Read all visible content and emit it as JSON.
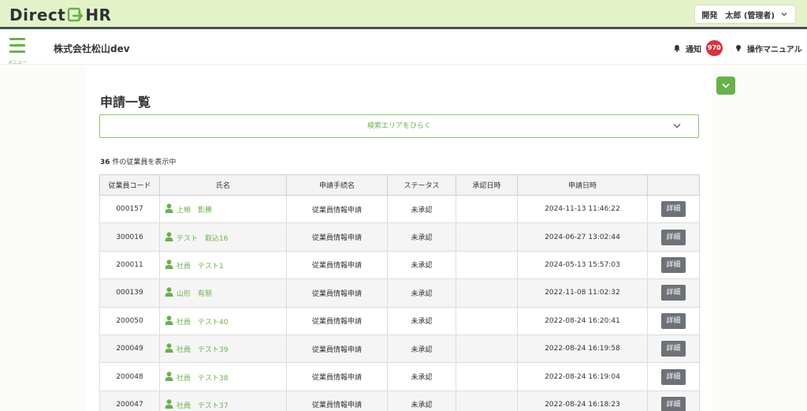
{
  "brand": {
    "logo_left": "Direct",
    "logo_right": "HR",
    "accent": "#6ab04c"
  },
  "user": {
    "label": "開発　太郎 (管理者)"
  },
  "header": {
    "menu_label": "メニュー",
    "company": "株式会社松山dev",
    "notify_label": "通知",
    "notify_count": "970",
    "manual_label": "操作マニュアル"
  },
  "page": {
    "title": "申請一覧",
    "search_toggle": "検索エリアをひらく",
    "count_number": "36",
    "count_suffix": "件の従業員を表示中"
  },
  "table": {
    "headers": [
      "従業員コード",
      "氏名",
      "申請手続名",
      "ステータス",
      "承認日時",
      "申請日時",
      ""
    ],
    "detail_label": "詳細",
    "rows": [
      {
        "code": "000157",
        "name": "上梢　影勝",
        "procedure": "従業員情報申請",
        "status": "未承認",
        "approved": "",
        "applied": "2024-11-13 11:46:22"
      },
      {
        "code": "300016",
        "name": "テスト　取込16",
        "procedure": "従業員情報申請",
        "status": "未承認",
        "approved": "",
        "applied": "2024-06-27 13:02:44"
      },
      {
        "code": "200011",
        "name": "社員　テスト1",
        "procedure": "従業員情報申請",
        "status": "未承認",
        "approved": "",
        "applied": "2024-05-13 15:57:03"
      },
      {
        "code": "000139",
        "name": "山形　有朋",
        "procedure": "従業員情報申請",
        "status": "未承認",
        "approved": "",
        "applied": "2022-11-08 11:02:32"
      },
      {
        "code": "200050",
        "name": "社員　テスト40",
        "procedure": "従業員情報申請",
        "status": "未承認",
        "approved": "",
        "applied": "2022-08-24 16:20:41"
      },
      {
        "code": "200049",
        "name": "社員　テスト39",
        "procedure": "従業員情報申請",
        "status": "未承認",
        "approved": "",
        "applied": "2022-08-24 16:19:58"
      },
      {
        "code": "200048",
        "name": "社員　テスト38",
        "procedure": "従業員情報申請",
        "status": "未承認",
        "approved": "",
        "applied": "2022-08-24 16:19:04"
      },
      {
        "code": "200047",
        "name": "社員　テスト37",
        "procedure": "従業員情報申請",
        "status": "未承認",
        "approved": "",
        "applied": "2022-08-24 16:18:23"
      }
    ]
  }
}
